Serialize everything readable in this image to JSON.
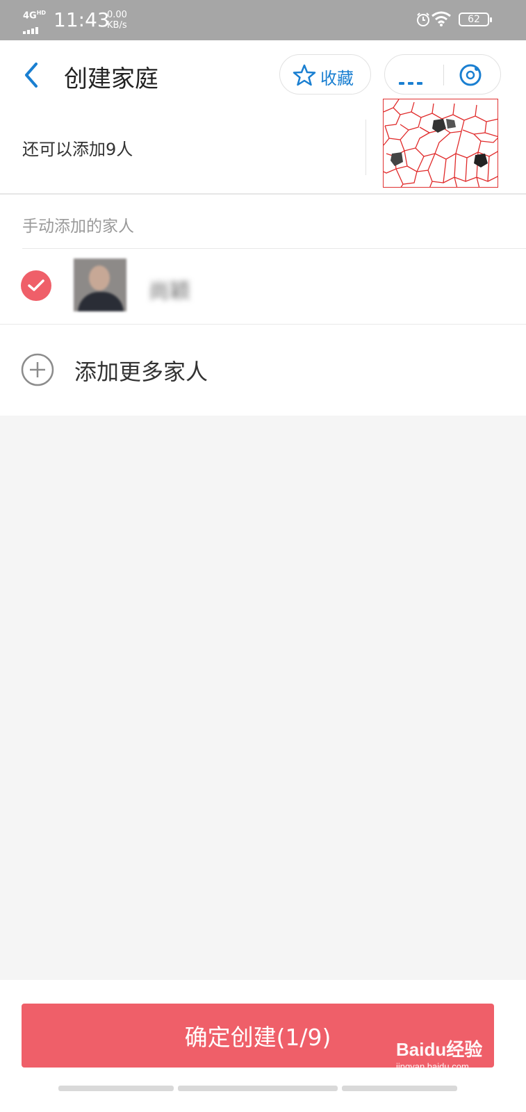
{
  "status_bar": {
    "network": "4G",
    "network_sup": "HD",
    "time": "11:43",
    "speed_value": "0.00",
    "speed_unit": "KB/s",
    "battery": "62",
    "icons": [
      "signal-icon",
      "alarm-icon",
      "wifi-icon",
      "battery-icon"
    ]
  },
  "header": {
    "title": "创建家庭",
    "favorite_label": "收藏",
    "remaining_text": "还可以添加9人"
  },
  "section": {
    "title": "手动添加的家人",
    "members": [
      {
        "name": "尚颖",
        "checked": true
      }
    ],
    "add_more_label": "添加更多家人"
  },
  "footer": {
    "confirm_label": "确定创建(1/9)"
  },
  "watermark": {
    "main": "Baidu经验",
    "sub": "jingyan.baidu.com"
  },
  "colors": {
    "accent_blue": "#1a7fd1",
    "primary_red": "#ef5f69",
    "background": "#f5f5f5"
  }
}
